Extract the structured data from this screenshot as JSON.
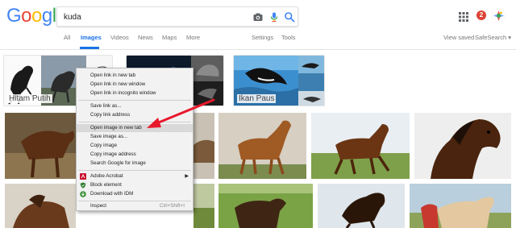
{
  "header": {
    "logo": [
      "G",
      "o",
      "o",
      "g",
      "l",
      "e"
    ],
    "logo_colors": [
      "#4285F4",
      "#EA4335",
      "#FBBC05",
      "#4285F4",
      "#34A853",
      "#EA4335"
    ],
    "query": "kuda",
    "notification_count": "2"
  },
  "nav": {
    "tabs": [
      "All",
      "Images",
      "Videos",
      "News",
      "Maps",
      "More"
    ],
    "active_tab": "Images",
    "settings": "Settings",
    "tools": "Tools",
    "view_saved": "View saved",
    "safesearch": "SafeSearch ▾"
  },
  "related": [
    {
      "label": "Hitam Putih"
    },
    {
      "label": ""
    },
    {
      "label": "Ikan Paus"
    }
  ],
  "context_menu": {
    "items": [
      {
        "label": "Open link in new tab"
      },
      {
        "label": "Open link in new window"
      },
      {
        "label": "Open link in incognito window"
      },
      {
        "label": "Save link as..."
      },
      {
        "label": "Copy link address"
      },
      {
        "label": "Open image in new tab",
        "highlighted": true
      },
      {
        "label": "Save image as..."
      },
      {
        "label": "Copy image"
      },
      {
        "label": "Copy image address"
      },
      {
        "label": "Search Google for image"
      },
      {
        "label": "Adobe Acrobat",
        "icon": "acrobat-icon",
        "submenu": true
      },
      {
        "label": "Block element",
        "icon": "shield-icon"
      },
      {
        "label": "Download with IDM",
        "icon": "idm-icon"
      },
      {
        "label": "Inspect",
        "shortcut": "Ctrl+Shift+I"
      }
    ]
  },
  "colors": {
    "accent": "#1a73e8",
    "arrow": "#e8192c",
    "menu_bg": "#f2f2f2",
    "menu_highlight": "#d9d9d9"
  }
}
